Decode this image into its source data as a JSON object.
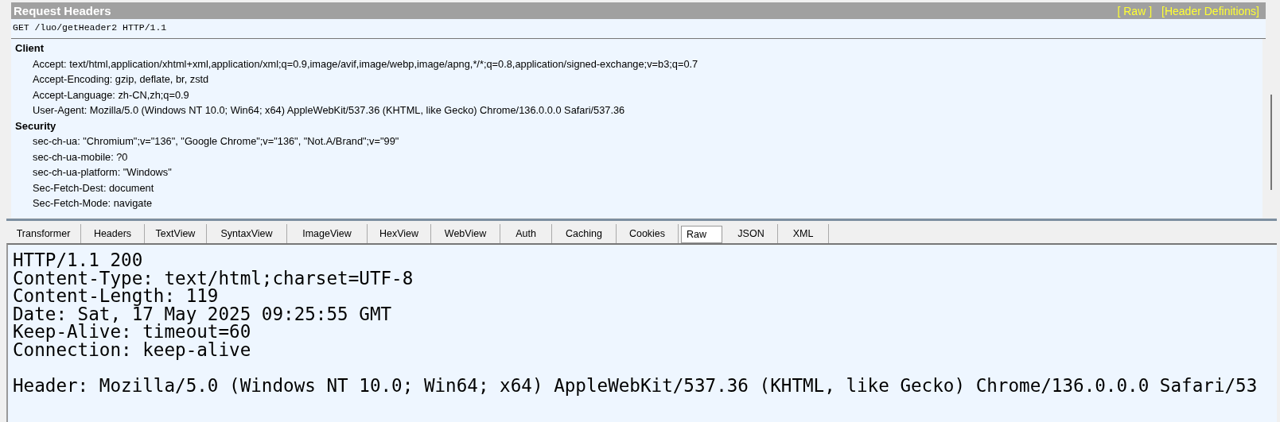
{
  "request_headers": {
    "title": "Request Headers",
    "links": [
      "[ Raw ]",
      "[Header Definitions]"
    ],
    "request_line": "GET /luo/getHeader2 HTTP/1.1",
    "groups": [
      {
        "name": "Client",
        "headers": [
          "Accept: text/html,application/xhtml+xml,application/xml;q=0.9,image/avif,image/webp,image/apng,*/*;q=0.8,application/signed-exchange;v=b3;q=0.7",
          "Accept-Encoding: gzip, deflate, br, zstd",
          "Accept-Language: zh-CN,zh;q=0.9",
          "User-Agent: Mozilla/5.0 (Windows NT 10.0; Win64; x64) AppleWebKit/537.36 (KHTML, like Gecko) Chrome/136.0.0.0 Safari/537.36"
        ]
      },
      {
        "name": "Security",
        "headers": [
          "sec-ch-ua: \"Chromium\";v=\"136\", \"Google Chrome\";v=\"136\", \"Not.A/Brand\";v=\"99\"",
          "sec-ch-ua-mobile: ?0",
          "sec-ch-ua-platform: \"Windows\"",
          "Sec-Fetch-Dest: document",
          "Sec-Fetch-Mode: navigate"
        ]
      }
    ]
  },
  "response_tabs": [
    {
      "label": "Transformer",
      "selected": false
    },
    {
      "label": "Headers",
      "selected": false
    },
    {
      "label": "TextView",
      "selected": false
    },
    {
      "label": "SyntaxView",
      "selected": false
    },
    {
      "label": "ImageView",
      "selected": false
    },
    {
      "label": "HexView",
      "selected": false
    },
    {
      "label": "WebView",
      "selected": false
    },
    {
      "label": "Auth",
      "selected": false
    },
    {
      "label": "Caching",
      "selected": false
    },
    {
      "label": "Cookies",
      "selected": false
    },
    {
      "label": "Raw",
      "selected": true
    },
    {
      "label": "JSON",
      "selected": false
    },
    {
      "label": "XML",
      "selected": false
    }
  ],
  "raw_response": {
    "head_lines": [
      "HTTP/1.1 200",
      "Content-Type: text/html;charset=UTF-8",
      "Content-Length: 119",
      "Date: Sat, 17 May 2025 09:25:55 GMT",
      "Keep-Alive: timeout=60",
      "Connection: keep-alive"
    ],
    "body_lines": [
      "Header: Mozilla/5.0 (Windows NT 10.0; Win64; x64) AppleWebKit/537.36 (KHTML, like Gecko) Chrome/136.0.0.0 Safari/53"
    ]
  }
}
